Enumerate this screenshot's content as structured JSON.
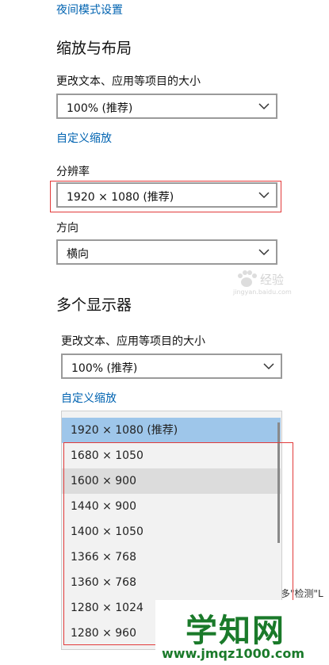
{
  "night_light_link": "夜间模式设置",
  "scale_section": {
    "heading": "缩放与布局",
    "scale_label": "更改文本、应用等项目的大小",
    "scale_value": "100% (推荐)",
    "custom_scaling_link": "自定义缩放",
    "resolution_label": "分辨率",
    "resolution_value": "1920 × 1080 (推荐)",
    "orientation_label": "方向",
    "orientation_value": "横向"
  },
  "multi_display": {
    "heading": "多个显示器",
    "scale_label": "更改文本、应用等项目的大小",
    "scale_value": "100% (推荐)",
    "custom_scaling_link": "自定义缩放"
  },
  "resolution_options": [
    "1920 × 1080 (推荐)",
    "1680 × 1050",
    "1600 × 900",
    "1440 × 900",
    "1400 × 1050",
    "1366 × 768",
    "1360 × 768",
    "1280 × 1024",
    "1280 × 960"
  ],
  "partial_text": "多\"检测\"L",
  "watermarks": {
    "baidu_text": "经验",
    "baidu_sub": "jingyan.baidu.com",
    "site_name": "学知网",
    "site_url": "www.jmqz1000.com"
  },
  "colors": {
    "link": "#0063b1",
    "selected": "#9ec6ea",
    "hover": "#dcdcdc",
    "highlight_box": "#e23a3a",
    "watermark_text": "#1a7a2a"
  },
  "icons": [
    "chevron-down-icon",
    "baidu-paw-icon"
  ]
}
